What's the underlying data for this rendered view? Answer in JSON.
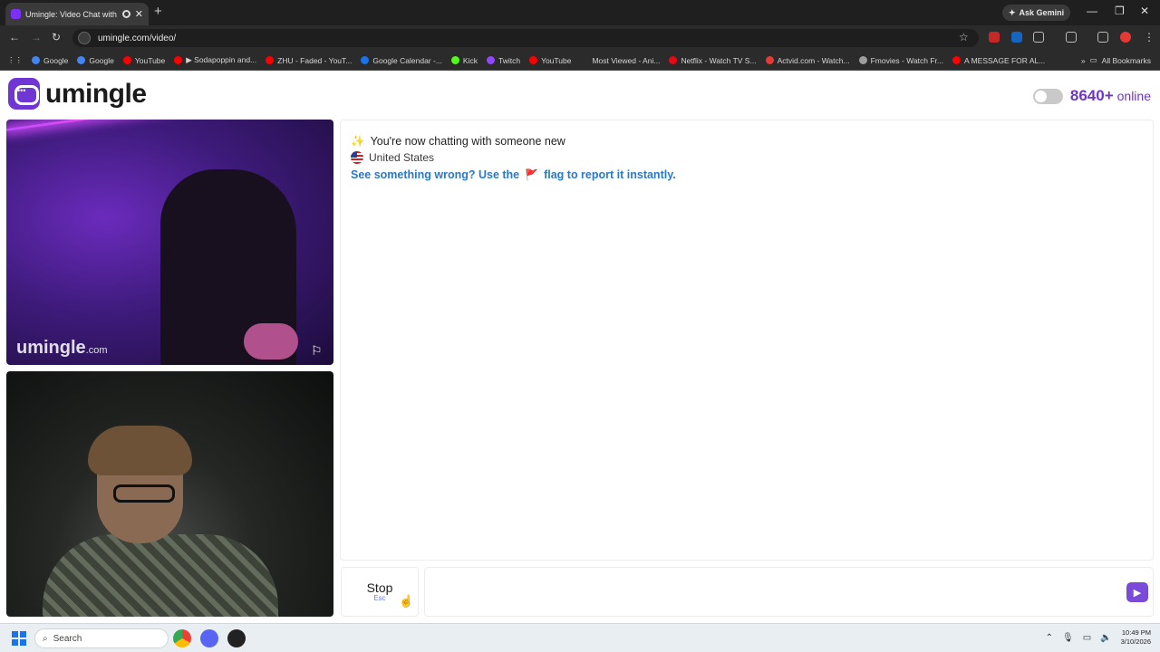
{
  "browser": {
    "tab_title": "Umingle: Video Chat with S",
    "new_tab_symbol": "+",
    "gemini_label": "Ask Gemini",
    "url": "umingle.com/video/",
    "bookmarks": [
      {
        "label": "Google",
        "color": "#4285f4"
      },
      {
        "label": "Google",
        "color": "#4285f4"
      },
      {
        "label": "YouTube",
        "color": "#ff0000"
      },
      {
        "label": "▶ Sodapoppin and...",
        "color": "#ff0000"
      },
      {
        "label": "ZHU - Faded - YouT...",
        "color": "#ff0000"
      },
      {
        "label": "Google Calendar -...",
        "color": "#1a73e8"
      },
      {
        "label": "Kick",
        "color": "#53fc18"
      },
      {
        "label": "Twitch",
        "color": "#9146ff"
      },
      {
        "label": "YouTube",
        "color": "#ff0000"
      },
      {
        "label": "Most Viewed - Ani...",
        "color": "#2b2b2b"
      },
      {
        "label": "Netflix - Watch TV S...",
        "color": "#e50914"
      },
      {
        "label": "Actvid.com - Watch...",
        "color": "#e53935"
      },
      {
        "label": "Fmovies - Watch Fr...",
        "color": "#9e9e9e"
      },
      {
        "label": "A MESSAGE FOR AL...",
        "color": "#ff0000"
      }
    ],
    "all_bookmarks": "All Bookmarks"
  },
  "site": {
    "logo_text": "umingle",
    "online_count": "8640+",
    "online_label": "online",
    "brand_color": "#6d36c9"
  },
  "video": {
    "watermark": "umingle",
    "watermark_suffix": ".com"
  },
  "chat": {
    "intro": "You're now chatting with someone new",
    "intro_icon": "✨",
    "country": "United States",
    "report_pre": "See something wrong? Use the",
    "report_flag": "🚩",
    "report_post": "flag to report it instantly.",
    "report_color": "#2a78c8"
  },
  "controls": {
    "stop_label": "Stop",
    "stop_shortcut": "Esc",
    "send_icon": "▶"
  },
  "taskbar": {
    "search_label": "Search",
    "time": "10:49 PM",
    "date": "3/10/2026"
  }
}
